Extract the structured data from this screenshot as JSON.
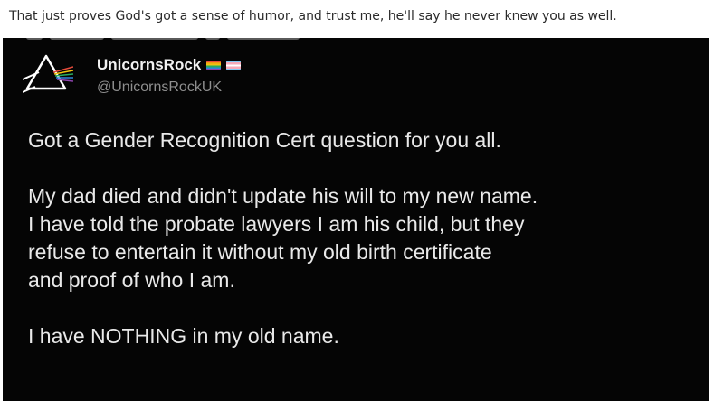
{
  "post": {
    "caption": "That just proves God's got a sense of humor, and trust me, he'll say he never knew you as well."
  },
  "tweet": {
    "display_name": "UnicornsRock",
    "handle": "@UnicornsRockUK",
    "avatar_icon": "prism-triangle-icon",
    "name_badges": [
      "rainbow-flag-icon",
      "trans-flag-icon"
    ],
    "paragraphs": [
      {
        "lines": [
          "Got a Gender Recognition Cert question for you all."
        ]
      },
      {
        "lines": [
          "My dad died and didn't update his will to my new name.",
          "I have told the probate lawyers I am his child, but they",
          "refuse to entertain it without my old birth certificate",
          "and proof of who I am."
        ]
      },
      {
        "lines": [
          "I have NOTHING in my old name."
        ]
      }
    ]
  },
  "colors": {
    "tweet_background": "#050505",
    "tweet_text": "#e9e9e9",
    "handle_text": "#8e8e8e",
    "caption_text": "#2b2b2b"
  }
}
